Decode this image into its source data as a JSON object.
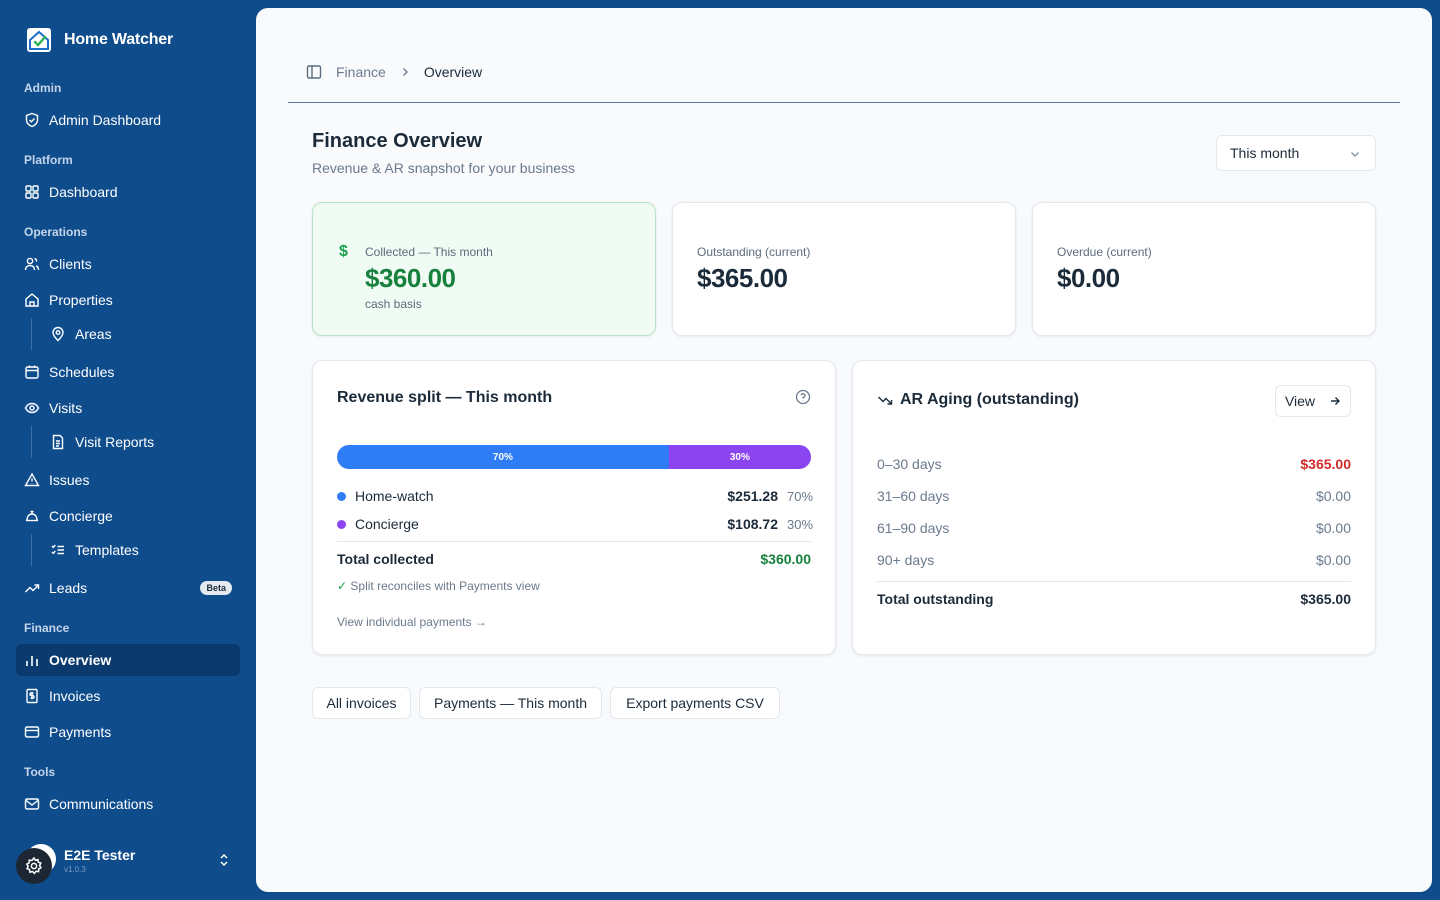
{
  "app": {
    "name": "Home Watcher"
  },
  "sidebar": {
    "sections": {
      "admin": "Admin",
      "platform": "Platform",
      "operations": "Operations",
      "finance": "Finance",
      "tools": "Tools"
    },
    "items": {
      "admin_dashboard": "Admin Dashboard",
      "dashboard": "Dashboard",
      "clients": "Clients",
      "properties": "Properties",
      "areas": "Areas",
      "schedules": "Schedules",
      "visits": "Visits",
      "visit_reports": "Visit Reports",
      "issues": "Issues",
      "concierge": "Concierge",
      "templates": "Templates",
      "leads": "Leads",
      "leads_badge": "Beta",
      "overview": "Overview",
      "invoices": "Invoices",
      "payments": "Payments",
      "communications": "Communications"
    },
    "active_item": "overview",
    "user": {
      "name": "E2E Tester",
      "version": "v1.0.3"
    }
  },
  "breadcrumb": {
    "parent": "Finance",
    "current": "Overview"
  },
  "header": {
    "title": "Finance Overview",
    "subtitle": "Revenue & AR snapshot for your business",
    "period_select": "This month"
  },
  "stats": {
    "collected": {
      "label": "Collected — This month",
      "value": "$360.00",
      "note": "cash basis",
      "icon": "$"
    },
    "outstanding": {
      "label": "Outstanding (current)",
      "value": "$365.00"
    },
    "overdue": {
      "label": "Overdue (current)",
      "value": "$0.00"
    }
  },
  "revenue_split": {
    "title": "Revenue split — This month",
    "bar": [
      {
        "label": "70%",
        "fraction": 0.7,
        "color": "#2f7df6"
      },
      {
        "label": "30%",
        "fraction": 0.3,
        "color": "#8b45f0"
      }
    ],
    "rows": [
      {
        "name": "Home-watch",
        "amount": "$251.28",
        "pct": "70%",
        "color": "#2f7df6"
      },
      {
        "name": "Concierge",
        "amount": "$108.72",
        "pct": "30%",
        "color": "#8b45f0"
      }
    ],
    "total_label": "Total collected",
    "total_value": "$360.00",
    "reconcile_check": "✓",
    "reconcile_note": "Split reconciles with Payments view",
    "view_link": "View individual payments →"
  },
  "ar_aging": {
    "title": "AR Aging (outstanding)",
    "view_button": "View",
    "rows": [
      {
        "label": "0–30 days",
        "value": "$365.00",
        "highlight": true
      },
      {
        "label": "31–60 days",
        "value": "$0.00",
        "highlight": false
      },
      {
        "label": "61–90 days",
        "value": "$0.00",
        "highlight": false
      },
      {
        "label": "90+ days",
        "value": "$0.00",
        "highlight": false
      }
    ],
    "total_label": "Total outstanding",
    "total_value": "$365.00"
  },
  "actions": {
    "all_invoices": "All invoices",
    "payments_month": "Payments — This month",
    "export_csv": "Export payments CSV"
  },
  "colors": {
    "sidebar_bg": "#0f4c8c",
    "collected_green": "#17803d",
    "overdue_red": "#d12a2a",
    "home_watch_blue": "#2f7df6",
    "concierge_purple": "#8b45f0"
  }
}
